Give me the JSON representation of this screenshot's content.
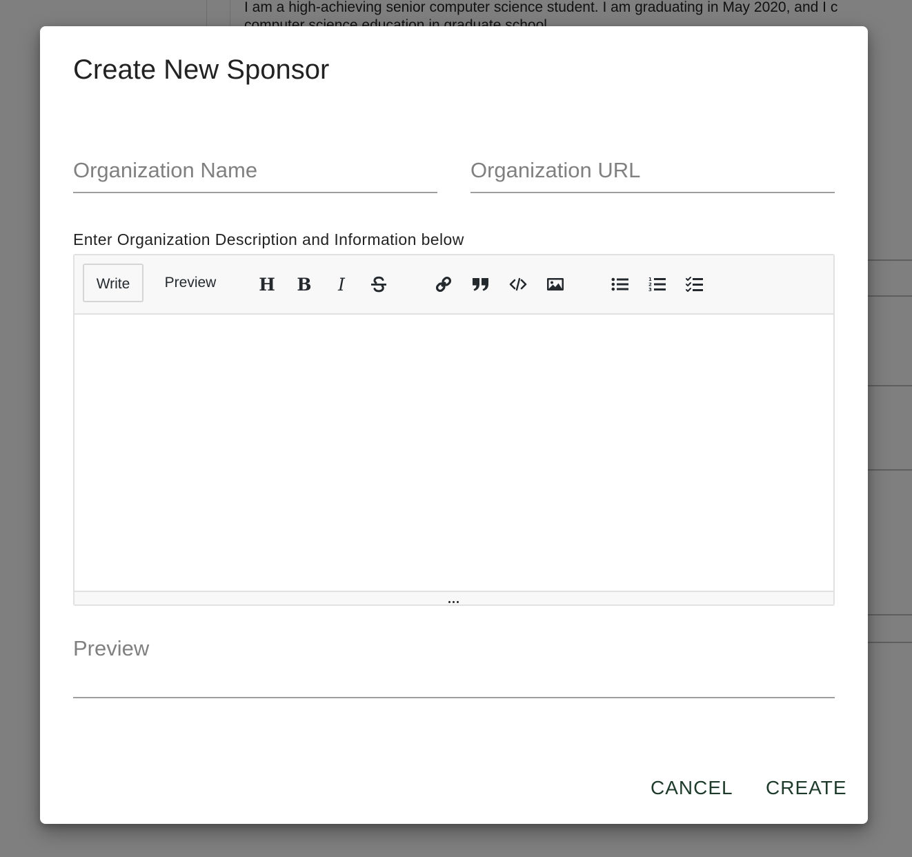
{
  "background": {
    "text_line_1": "I am a high-achieving senior computer science student. I am graduating in May 2020, and I c",
    "text_line_2": "computer science education in graduate school"
  },
  "dialog": {
    "title": "Create New Sponsor",
    "organization_name": {
      "placeholder": "Organization Name",
      "value": ""
    },
    "organization_url": {
      "placeholder": "Organization URL",
      "value": ""
    },
    "description_label": "Enter Organization Description and Information below",
    "editor": {
      "tabs": {
        "write": "Write",
        "preview": "Preview"
      },
      "active_tab": "Write",
      "toolbar_icons": [
        "header-icon",
        "bold-icon",
        "italic-icon",
        "strikethrough-icon",
        "link-icon",
        "quote-icon",
        "code-icon",
        "image-icon",
        "unordered-list-icon",
        "ordered-list-icon",
        "checklist-icon"
      ],
      "toolbar_glyphs": {
        "header": "H",
        "bold": "B",
        "italic": "I"
      },
      "content": ""
    },
    "preview_label": "Preview",
    "actions": {
      "cancel": "CANCEL",
      "create": "CREATE"
    },
    "colors": {
      "action_text": "#1d3a2a",
      "overlay": "rgba(0,0,0,0.5)"
    }
  }
}
